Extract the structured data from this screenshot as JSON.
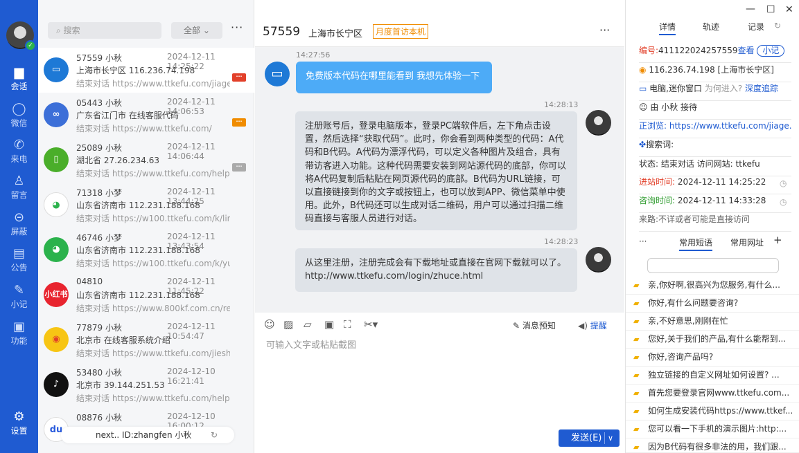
{
  "nav": {
    "items": [
      {
        "label": "会话",
        "icon": "chat-bubble-icon"
      },
      {
        "label": "微信",
        "icon": "wechat-icon"
      },
      {
        "label": "来电",
        "icon": "phone-icon"
      },
      {
        "label": "留言",
        "icon": "message-icon"
      },
      {
        "label": "屏蔽",
        "icon": "block-icon"
      },
      {
        "label": "公告",
        "icon": "notice-icon"
      },
      {
        "label": "小记",
        "icon": "pen-icon"
      },
      {
        "label": "功能",
        "icon": "chart-icon"
      },
      {
        "label": "设置",
        "icon": "gear-icon"
      }
    ]
  },
  "list": {
    "search_placeholder": "搜索",
    "filter": "全部",
    "more": "···",
    "items": [
      {
        "id": "57559",
        "agent": "小秋",
        "time": "2024-12-11 14:25:22",
        "loc": "上海市长宁区   116.236.74.198",
        "last": "结束对话 https://www.ttkefu.com/jiage.htr",
        "avatar": "pc",
        "badge": "···",
        "badge_color": "#e2402a"
      },
      {
        "id": "05443",
        "agent": "小秋",
        "time": "2024-12-11 14:06:53",
        "loc": "广东省江门市   在线客服代码",
        "last": "结束对话 https://www.ttkefu.com/",
        "avatar": "link",
        "badge": "···",
        "badge_color": "#f08c00"
      },
      {
        "id": "25089",
        "agent": "小秋",
        "time": "2024-12-11 14:06:44",
        "loc": "湖北省   27.26.234.63",
        "last": "结束对话 https://www.ttkefu.com/helpsho",
        "avatar": "phone",
        "badge": "···",
        "badge_color": "#aaaaaa"
      },
      {
        "id": "71318",
        "agent": "小梦",
        "time": "2024-12-11 13:44:25",
        "loc": "山东省济南市   112.231.188.168",
        "last": "结束对话 https://w100.ttkefu.com/k/linkurl",
        "avatar": "wechat-white"
      },
      {
        "id": "46746",
        "agent": "小梦",
        "time": "2024-12-11 13:43:54",
        "loc": "山东省济南市   112.231.188.168",
        "last": "结束对话 https://w100.ttkefu.com/k/yulan.",
        "avatar": "wechat-green"
      },
      {
        "id": "04810",
        "agent": "",
        "time": "2024-12-11 11:45:22",
        "loc": "山东省济南市   112.231.188.168",
        "last": "结束对话 https://www.800kf.com.cn/reg.h",
        "avatar": "xhs",
        "avatar_text": "小红书"
      },
      {
        "id": "77879",
        "agent": "小秋",
        "time": "2024-12-11 10:54:47",
        "loc": "北京市   在线客服系统介绍",
        "last": "结束对话 https://www.ttkefu.com/jieshao.",
        "avatar": "weibo"
      },
      {
        "id": "53480",
        "agent": "小秋",
        "time": "2024-12-10 16:21:41",
        "loc": "北京市   39.144.251.53",
        "last": "结束对话 https://www.ttkefu.com/helpsho",
        "avatar": "tiktok"
      },
      {
        "id": "08876",
        "agent": "小秋",
        "time": "2024-12-10 16:00:12",
        "loc": "",
        "last": "",
        "avatar": "baidu"
      }
    ],
    "footer": "next..  ID:zhangfen  小秋"
  },
  "chat": {
    "number": "57559",
    "location": "上海市长宁区",
    "tag": "月度首访本机",
    "more": "···",
    "messages": [
      {
        "time": "14:27:56",
        "text": "免费版本代码在哪里能看到  我想先体验一下",
        "from": "visitor"
      },
      {
        "time": "14:28:13",
        "text": "注册账号后，登录电脑版本，登录PC端软件后，左下角点击设置，然后选择“获取代码”。此时，你会看到两种类型的代码：A代码和B代码。A代码为漂浮代码，可以定义各种图片及组合，具有带访客进入功能。这种代码需要安装到网站源代码的底部，你可以将A代码复制后粘贴在网页源代码的底部。B代码为URL链接，可以直接链接到你的文字或按钮上，也可以放到APP、微信菜单中使用。此外，B代码还可以生成对话二维码，用户可以通过扫描二维码直接与客服人员进行对话。",
        "from": "agent"
      },
      {
        "time": "14:28:23",
        "text": "从这里注册，注册完成会有下载地址或直接在官网下载就可以了。http://www.ttkefu.com/login/zhuce.html",
        "from": "agent"
      }
    ],
    "toolbar": {
      "preview": "消息预知",
      "remind": "提醒"
    },
    "input_placeholder": "可输入文字或粘贴截图",
    "send": "发送(E)"
  },
  "side": {
    "tabs": [
      "详情",
      "轨迹",
      "记录"
    ],
    "details": {
      "id_label": "编号:",
      "id_value": "411122024257559",
      "view": "查看",
      "note_btn": "小记",
      "ip": "116.236.74.198 [上海市长宁区]",
      "device": "电脑,迷你窗口",
      "why": "为何进入?",
      "track": "深度追踪",
      "by_prefix": "由",
      "by_agent": "小秋",
      "by_suffix": "接待",
      "browsing_label": "正浏览:",
      "browsing_url": "https://www.ttkefu.com/jiage.h...",
      "keyword_label": "搜索词:",
      "status_text": "状态: 结束对话  访问网站: ttkefu",
      "enter_label": "进站时间:",
      "enter_time": "2024-12-11 14:25:22",
      "consult_label": "咨询时间:",
      "consult_time": "2024-12-11 14:33:28",
      "source": "来路:不详或者可能是直接访问"
    },
    "quick_tabs": [
      "常用短语",
      "常用网址"
    ],
    "quick_more": "···",
    "quick_add": "+",
    "phrases": [
      "亲,你好啊,很高兴为您服务,有什么...",
      "你好,有什么问题要咨询?",
      "亲,不好意思,刚刚在忙",
      "您好,关于我们的产品,有什么能帮到...",
      "你好,咨询产品吗?",
      "独立链接的自定义网址如何设置? ...",
      "首先您要登录官网www.ttkefu.com...",
      "如何生成安装代码https://www.ttkef...",
      "您可以看一下手机的演示图片:http:...",
      "因为B代码有很多非法的用，我们跟..."
    ]
  }
}
